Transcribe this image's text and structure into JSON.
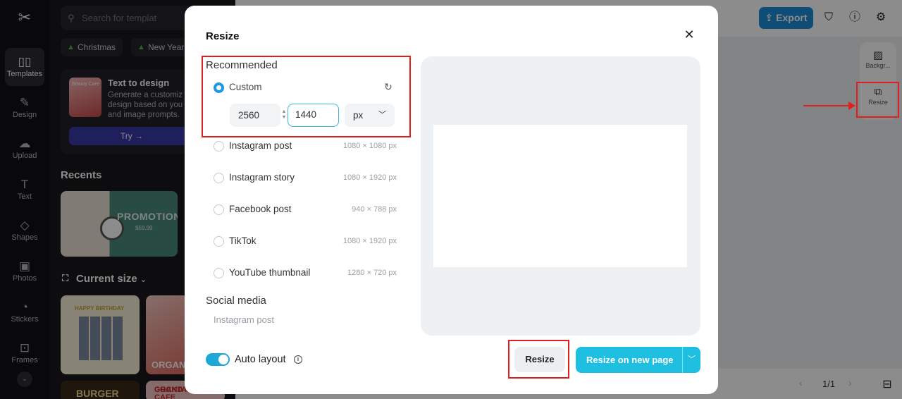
{
  "sidebar": {
    "logo": "✂",
    "items": [
      {
        "label": "Templates",
        "icon": "templates-icon"
      },
      {
        "label": "Design",
        "icon": "design-icon"
      },
      {
        "label": "Upload",
        "icon": "upload-icon"
      },
      {
        "label": "Text",
        "icon": "text-icon"
      },
      {
        "label": "Shapes",
        "icon": "shapes-icon"
      },
      {
        "label": "Photos",
        "icon": "photos-icon"
      },
      {
        "label": "Stickers",
        "icon": "stickers-icon"
      },
      {
        "label": "Frames",
        "icon": "frames-icon"
      }
    ],
    "collapse_glyph": "⌄"
  },
  "panel": {
    "search_placeholder": "Search for templat",
    "chips": [
      {
        "label": "Christmas"
      },
      {
        "label": "New Year"
      }
    ],
    "text_to_design": {
      "thumb_text": "Beauty Care",
      "title": "Text to design",
      "description": [
        "Generate a customiz",
        "design based on you",
        "and image prompts."
      ],
      "try_label": "Try →"
    },
    "recents_title": "Recents",
    "recent_promo": {
      "title": "PROMOTION",
      "price": "$59.99"
    },
    "current_size_title": "Current size",
    "templates": {
      "birthday": "HAPPY BIRTHDAY",
      "organic": "ORGANIC",
      "burger": "BURGER",
      "cocktail_line1": "GRAND",
      "cocktail_line2": "COCKTAIL CAFE"
    }
  },
  "topbar": {
    "export_label": "Export"
  },
  "right_panel": {
    "items": [
      {
        "label": "Backgr..."
      },
      {
        "label": "Resize"
      }
    ]
  },
  "pager": {
    "label": "1/1"
  },
  "modal": {
    "title": "Resize",
    "recommended_title": "Recommended",
    "custom": {
      "label": "Custom",
      "width": "2560",
      "height": "1440",
      "unit": "px"
    },
    "options": [
      {
        "label": "Instagram post",
        "size": "1080 × 1080 px"
      },
      {
        "label": "Instagram story",
        "size": "1080 × 1920 px"
      },
      {
        "label": "Facebook post",
        "size": "940 × 788 px"
      },
      {
        "label": "TikTok",
        "size": "1080 × 1920 px"
      },
      {
        "label": "YouTube thumbnail",
        "size": "1280 × 720 px"
      }
    ],
    "social_title": "Social media",
    "social_sub": "Instagram post",
    "auto_layout_label": "Auto layout",
    "resize_button": "Resize",
    "resize_new_page_button": "Resize on new page"
  },
  "colors": {
    "accent": "#1fbfe2",
    "export": "#1c8ad8",
    "annotation": "#e02020"
  }
}
